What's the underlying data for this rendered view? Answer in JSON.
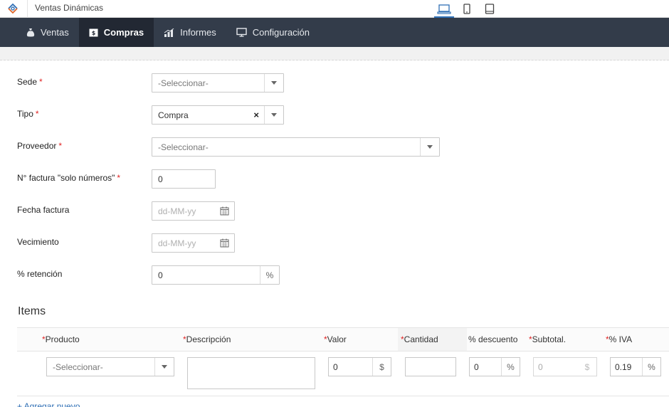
{
  "app": {
    "title": "Ventas Dinámicas"
  },
  "nav": [
    {
      "label": "Ventas",
      "icon": "money-bag-icon",
      "active": false
    },
    {
      "label": "Compras",
      "icon": "receipt-icon",
      "active": true
    },
    {
      "label": "Informes",
      "icon": "chart-icon",
      "active": false
    },
    {
      "label": "Configuración",
      "icon": "monitor-icon",
      "active": false
    }
  ],
  "form": {
    "sede": {
      "label": "Sede",
      "placeholder": "-Seleccionar-"
    },
    "tipo": {
      "label": "Tipo",
      "value": "Compra",
      "clear": "×"
    },
    "proveedor": {
      "label": "Proveedor",
      "placeholder": "-Seleccionar-"
    },
    "factura": {
      "label": "N° factura \"solo números\"",
      "value": "0"
    },
    "fecha": {
      "label": "Fecha factura",
      "placeholder": "dd-MM-yy"
    },
    "vencimiento": {
      "label": "Vecimiento",
      "placeholder": "dd-MM-yy"
    },
    "retencion": {
      "label": "% retención",
      "value": "0",
      "unit": "%"
    },
    "required_mark": "*"
  },
  "items": {
    "title": "Items",
    "columns": [
      "Producto",
      "Descripción",
      "Valor",
      "Cantidad",
      "% descuento",
      "Subtotal.",
      "% IVA"
    ],
    "row": {
      "producto_placeholder": "-Seleccionar-",
      "descripcion": "",
      "valor": "0",
      "valor_unit": "$",
      "cantidad": "",
      "descuento": "0",
      "descuento_unit": "%",
      "subtotal": "0",
      "subtotal_unit": "$",
      "iva": "0.19",
      "iva_unit": "%"
    },
    "add_new": "+ Agregar nuevo"
  }
}
